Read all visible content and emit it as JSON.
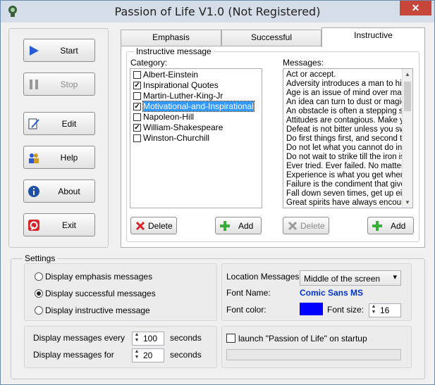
{
  "window": {
    "title": "Passion of Life V1.0 (Not Registered)",
    "close_glyph": "✕"
  },
  "sidebar": {
    "buttons": [
      {
        "label": "Start",
        "icon": "play-icon"
      },
      {
        "label": "Stop",
        "icon": "pause-icon"
      },
      {
        "label": "Edit",
        "icon": "edit-icon"
      },
      {
        "label": "Help",
        "icon": "help-icon"
      },
      {
        "label": "About",
        "icon": "info-icon"
      },
      {
        "label": "Exit",
        "icon": "exit-icon"
      }
    ]
  },
  "tabs": [
    "Emphasis",
    "Successful",
    "Instructive"
  ],
  "instructive": {
    "group_title": "Instructive message",
    "category_label": "Category:",
    "messages_label": "Messages:",
    "categories": [
      {
        "label": "Albert-Einstein",
        "checked": false
      },
      {
        "label": "Inspirational Quotes",
        "checked": true
      },
      {
        "label": "Martin-Luther-King-Jr",
        "checked": false
      },
      {
        "label": "Motivational-and-Inspirational",
        "checked": true,
        "selected": true
      },
      {
        "label": "Napoleon-Hill",
        "checked": false
      },
      {
        "label": "William-Shakespeare",
        "checked": true
      },
      {
        "label": "Winston-Churchill",
        "checked": false
      }
    ],
    "messages": [
      "Act or accept.",
      "Adversity introduces a man to hims",
      "Age is an issue of mind over matte",
      "An idea can turn to dust or magic,",
      "An obstacle is often a stepping sto",
      "Attitudes are contagious. Make yo",
      "Defeat is not bitter unless you swa",
      "Do first things first, and second thi",
      "Do not let what you cannot do inte",
      "Do not wait to strike till the iron is h",
      "Ever tried. Ever failed. No matter.",
      "Experience is what you get when y",
      "Failure is the condiment that gives",
      "Fall down seven times, get up eigh",
      "Great spirits have always encounte"
    ],
    "cat_delete": "Delete",
    "cat_add": "Add",
    "msg_delete": "Delete",
    "msg_add": "Add"
  },
  "settings": {
    "title": "Settings",
    "radios": [
      {
        "label": "Display emphasis messages",
        "on": false
      },
      {
        "label": "Display successful messages",
        "on": true
      },
      {
        "label": "Display instructive message",
        "on": false
      }
    ],
    "location_label": "Location Messages:",
    "location_value": "Middle of the screen",
    "font_name_label": "Font Name:",
    "font_name_value": "Comic Sans MS",
    "font_color_label": "Font color:",
    "font_color_value": "#0000ff",
    "font_size_label": "Font size:",
    "font_size_value": "16",
    "every_label": "Display messages every",
    "every_value": "100",
    "every_unit": "seconds",
    "for_label": "Display messages for",
    "for_value": "20",
    "for_unit": "seconds",
    "startup_label": "launch \"Passion of Life\" on startup",
    "startup_checked": false
  },
  "colors": {
    "accent": "#3399ff",
    "font_name_color": "#0033cc",
    "close": "#c7463a"
  }
}
